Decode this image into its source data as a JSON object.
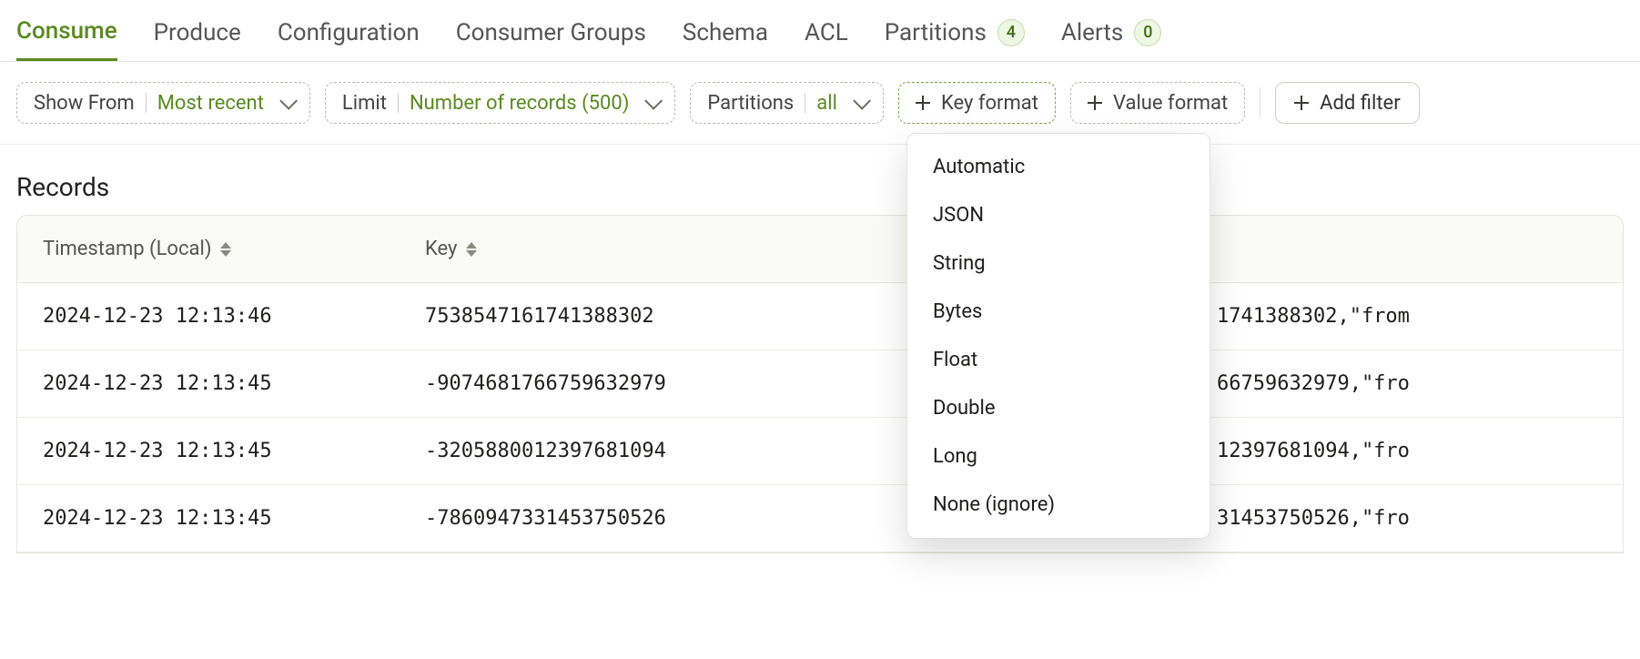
{
  "tabs": [
    {
      "label": "Consume",
      "badge": null,
      "active": true
    },
    {
      "label": "Produce",
      "badge": null,
      "active": false
    },
    {
      "label": "Configuration",
      "badge": null,
      "active": false
    },
    {
      "label": "Consumer Groups",
      "badge": null,
      "active": false
    },
    {
      "label": "Schema",
      "badge": null,
      "active": false
    },
    {
      "label": "ACL",
      "badge": null,
      "active": false
    },
    {
      "label": "Partitions",
      "badge": "4",
      "active": false
    },
    {
      "label": "Alerts",
      "badge": "0",
      "active": false
    }
  ],
  "filters": {
    "show_from": {
      "label": "Show From",
      "value": "Most recent"
    },
    "limit": {
      "label": "Limit",
      "value": "Number of records (500)"
    },
    "partitions": {
      "label": "Partitions",
      "value": "all"
    },
    "key_format": {
      "label": "Key format"
    },
    "value_format": {
      "label": "Value format"
    },
    "add_filter": {
      "label": "Add filter"
    }
  },
  "key_format_menu": [
    "Automatic",
    "JSON",
    "String",
    "Bytes",
    "Float",
    "Double",
    "Long",
    "None (ignore)"
  ],
  "section_title": "Records",
  "columns": {
    "timestamp": "Timestamp (Local)",
    "key": "Key"
  },
  "rows": [
    {
      "ts": "2024-12-23 12:13:46",
      "key": "7538547161741388302",
      "val": "1741388302,\"from"
    },
    {
      "ts": "2024-12-23 12:13:45",
      "key": "-9074681766759632979",
      "val": "66759632979,\"fro"
    },
    {
      "ts": "2024-12-23 12:13:45",
      "key": "-3205880012397681094",
      "val": "12397681094,\"fro"
    },
    {
      "ts": "2024-12-23 12:13:45",
      "key": "-7860947331453750526",
      "val": "31453750526,\"fro"
    }
  ]
}
